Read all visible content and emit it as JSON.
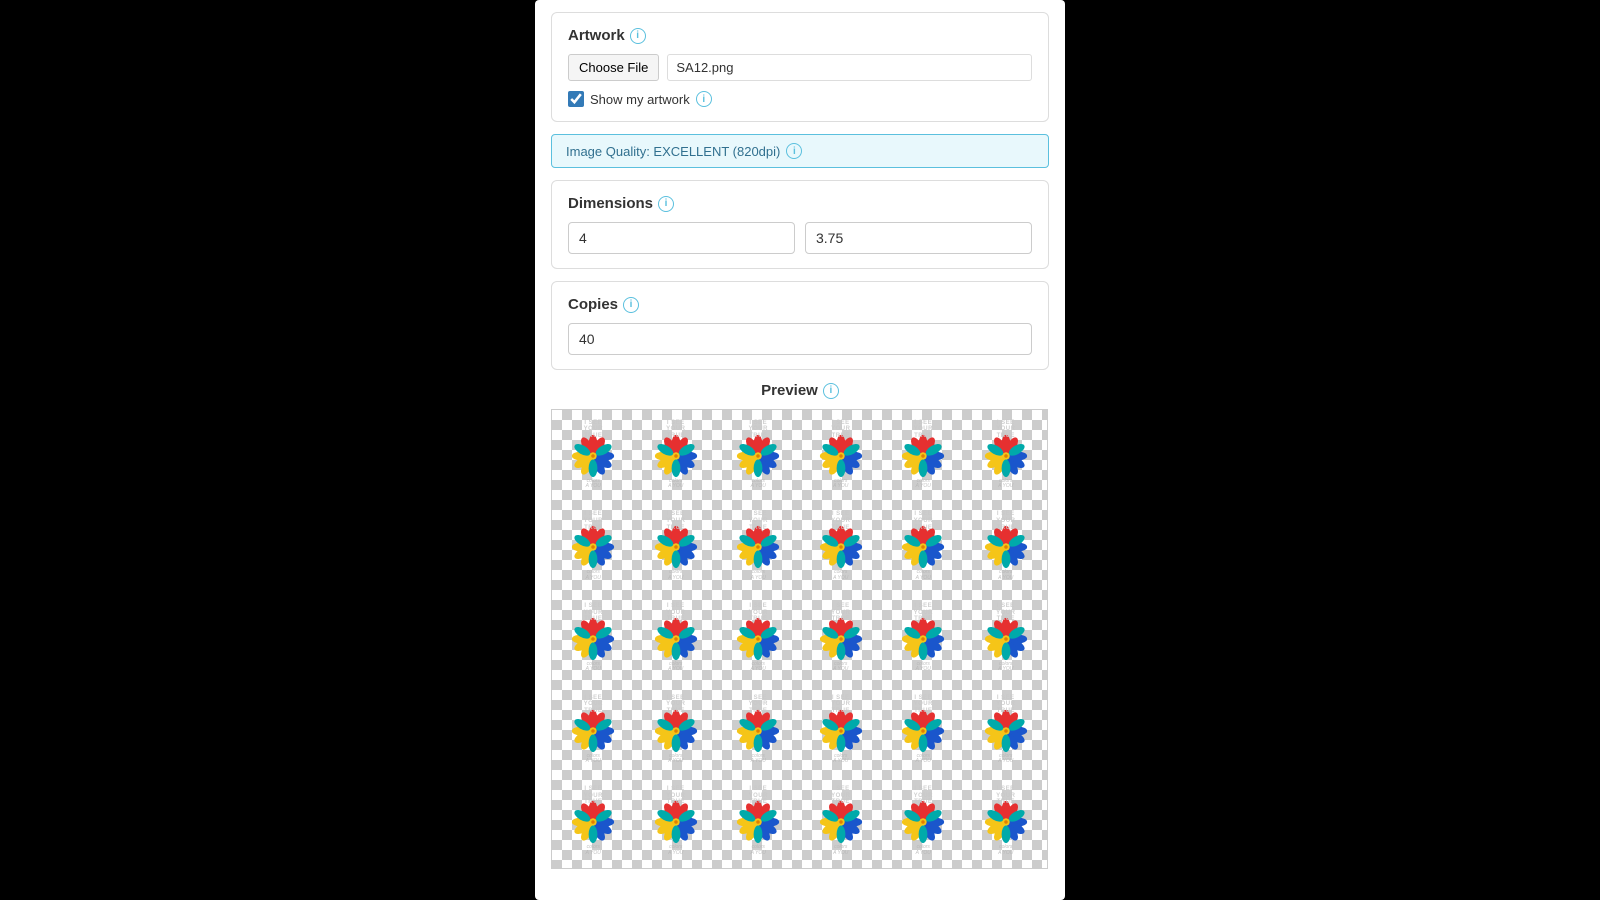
{
  "artwork": {
    "label": "Artwork",
    "choose_file_label": "Choose File",
    "file_name": "SA12.png",
    "show_artwork_label": "Show my artwork",
    "show_artwork_checked": true
  },
  "image_quality": {
    "label": "Image Quality: EXCELLENT (820dpi)"
  },
  "dimensions": {
    "label": "Dimensions",
    "width_value": "4",
    "height_value": "3.75"
  },
  "copies": {
    "label": "Copies",
    "value": "40"
  },
  "preview": {
    "label": "Preview"
  },
  "sticker_text": {
    "line1": "I SEE",
    "line2": "YOUR",
    "line3": "TRUE",
    "line4": "colors",
    "line5": "A YOU"
  },
  "colors": {
    "quality_bg": "#e8f8fc",
    "quality_border": "#5bc0de",
    "quality_text": "#31708f",
    "info_icon": "#5bc0de"
  }
}
